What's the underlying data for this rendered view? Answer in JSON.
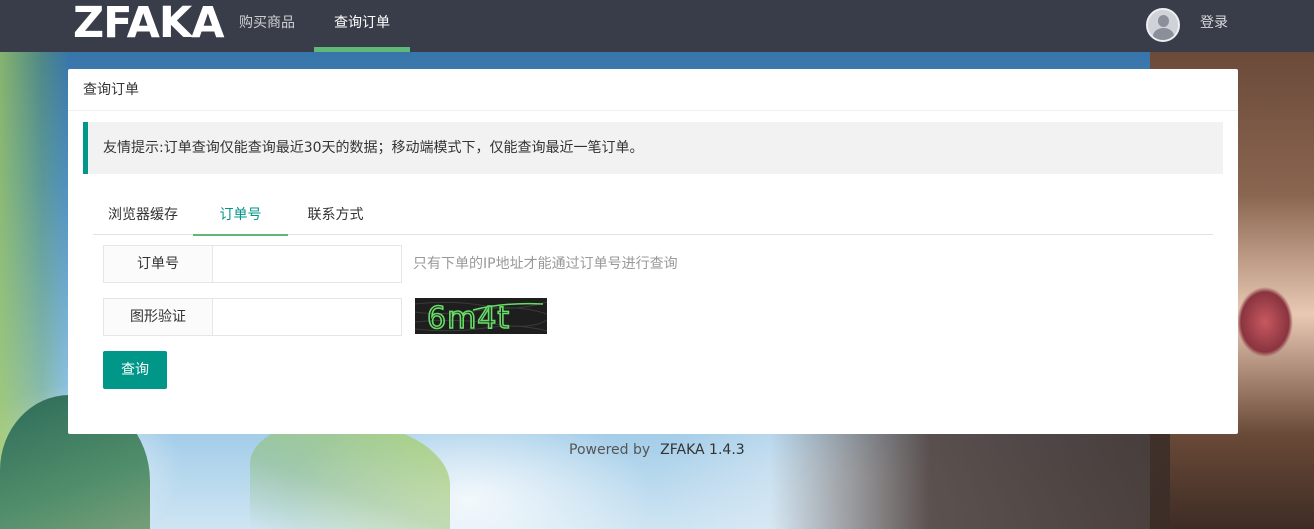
{
  "nav": {
    "logo": "ZFAKA",
    "items": [
      {
        "label": "购买商品"
      },
      {
        "label": "查询订单"
      }
    ],
    "login_label": "登录",
    "active_color": "#5fb878"
  },
  "card": {
    "title": "查询订单",
    "tip": "友情提示:订单查询仅能查询最近30天的数据；移动端模式下，仅能查询最近一笔订单。",
    "tabs": [
      {
        "label": "浏览器缓存"
      },
      {
        "label": "订单号"
      },
      {
        "label": "联系方式"
      }
    ],
    "active_tab": "订单号",
    "order_field": {
      "label": "订单号",
      "value": "",
      "hint": "只有下单的IP地址才能通过订单号进行查询"
    },
    "captcha_field": {
      "label": "图形验证",
      "value": "",
      "captcha_text": "6m4t"
    },
    "submit_label": "查询"
  },
  "footer": {
    "powered_by": "Powered by",
    "brand": "ZFAKA 1.4.3"
  },
  "colors": {
    "navbar": "#393d49",
    "accent": "#009688",
    "tip_border": "#009688"
  }
}
